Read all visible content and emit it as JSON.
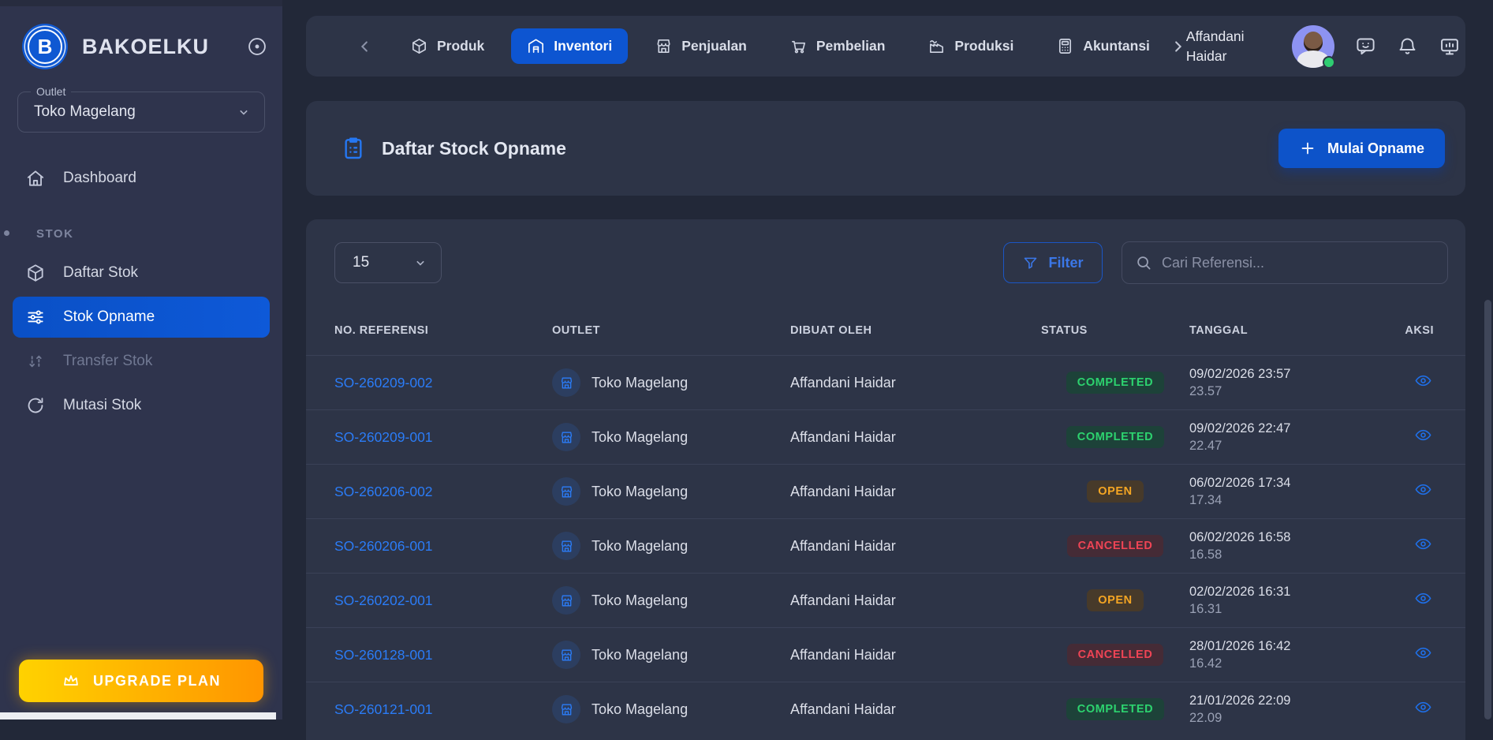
{
  "brand": {
    "name": "BAKOELKU",
    "logo_symbol": "B"
  },
  "sidebar": {
    "outlet": {
      "label": "Outlet",
      "value": "Toko Magelang"
    },
    "top_items": [
      {
        "id": "dashboard",
        "label": "Dashboard",
        "icon": "home",
        "state": "default"
      }
    ],
    "section_label": "STOK",
    "section_items": [
      {
        "id": "daftar-stok",
        "label": "Daftar Stok",
        "icon": "cube",
        "state": "default"
      },
      {
        "id": "stok-opname",
        "label": "Stok Opname",
        "icon": "sliders",
        "state": "active"
      },
      {
        "id": "transfer-stok",
        "label": "Transfer Stok",
        "icon": "transfer",
        "state": "muted"
      },
      {
        "id": "mutasi-stok",
        "label": "Mutasi Stok",
        "icon": "refresh",
        "state": "default"
      }
    ],
    "upgrade_label": "UPGRADE PLAN"
  },
  "topnav": {
    "items": [
      {
        "id": "produk",
        "label": "Produk",
        "icon": "cube",
        "active": false
      },
      {
        "id": "inventori",
        "label": "Inventori",
        "icon": "warehouse",
        "active": true
      },
      {
        "id": "penjualan",
        "label": "Penjualan",
        "icon": "store",
        "active": false
      },
      {
        "id": "pembelian",
        "label": "Pembelian",
        "icon": "cart",
        "active": false
      },
      {
        "id": "produksi",
        "label": "Produksi",
        "icon": "factory",
        "active": false
      },
      {
        "id": "akuntansi",
        "label": "Akuntansi",
        "icon": "calculator",
        "active": false
      }
    ],
    "user_name": "Affandani Haidar"
  },
  "page": {
    "title": "Daftar Stock Opname",
    "action_label": "Mulai Opname"
  },
  "controls": {
    "page_size": "15",
    "filter_label": "Filter",
    "search_placeholder": "Cari Referensi..."
  },
  "table": {
    "columns": [
      "NO. REFERENSI",
      "OUTLET",
      "DIBUAT OLEH",
      "STATUS",
      "TANGGAL",
      "AKSI"
    ],
    "rows": [
      {
        "ref": "SO-260209-002",
        "outlet": "Toko Magelang",
        "created_by": "Affandani Haidar",
        "status": "COMPLETED",
        "date": "09/02/2026 23:57",
        "time": "23.57"
      },
      {
        "ref": "SO-260209-001",
        "outlet": "Toko Magelang",
        "created_by": "Affandani Haidar",
        "status": "COMPLETED",
        "date": "09/02/2026 22:47",
        "time": "22.47"
      },
      {
        "ref": "SO-260206-002",
        "outlet": "Toko Magelang",
        "created_by": "Affandani Haidar",
        "status": "OPEN",
        "date": "06/02/2026 17:34",
        "time": "17.34"
      },
      {
        "ref": "SO-260206-001",
        "outlet": "Toko Magelang",
        "created_by": "Affandani Haidar",
        "status": "CANCELLED",
        "date": "06/02/2026 16:58",
        "time": "16.58"
      },
      {
        "ref": "SO-260202-001",
        "outlet": "Toko Magelang",
        "created_by": "Affandani Haidar",
        "status": "OPEN",
        "date": "02/02/2026 16:31",
        "time": "16.31"
      },
      {
        "ref": "SO-260128-001",
        "outlet": "Toko Magelang",
        "created_by": "Affandani Haidar",
        "status": "CANCELLED",
        "date": "28/01/2026 16:42",
        "time": "16.42"
      },
      {
        "ref": "SO-260121-001",
        "outlet": "Toko Magelang",
        "created_by": "Affandani Haidar",
        "status": "COMPLETED",
        "date": "21/01/2026 22:09",
        "time": "22.09"
      }
    ]
  },
  "colors": {
    "accent_blue": "#0d55d1",
    "link_blue": "#2b7cf7",
    "status": {
      "COMPLETED": {
        "text": "#2dd36f",
        "bg": "#1d4239"
      },
      "OPEN": {
        "text": "#f5a623",
        "bg": "#473a2a"
      },
      "CANCELLED": {
        "text": "#ef4455",
        "bg": "#452b36"
      }
    },
    "upgrade_gradient": [
      "#ffd200",
      "#ff9500"
    ]
  }
}
